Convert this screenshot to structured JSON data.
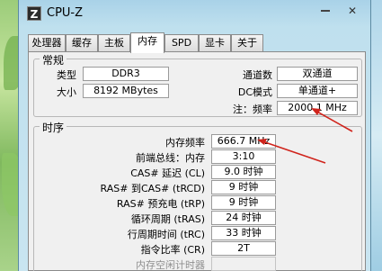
{
  "window": {
    "title": "CPU-Z",
    "icon_letter": "Z",
    "close_glyph": "✕"
  },
  "tabs": [
    {
      "label": "处理器"
    },
    {
      "label": "缓存"
    },
    {
      "label": "主板"
    },
    {
      "label": "内存"
    },
    {
      "label": "SPD"
    },
    {
      "label": "显卡"
    },
    {
      "label": "关于"
    }
  ],
  "active_tab": "内存",
  "general": {
    "title": "常规",
    "type_label": "类型",
    "type_value": "DDR3",
    "size_label": "大小",
    "size_value": "8192 MBytes",
    "channels_label": "通道数",
    "channels_value": "双通道",
    "dc_label": "DC模式",
    "dc_value": "单通道+",
    "freq_label": "注：频率",
    "freq_value": "2000.1 MHz"
  },
  "timings": {
    "title": "时序",
    "rows": [
      {
        "label": "内存频率",
        "value": "666.7 MHz"
      },
      {
        "label": "前端总线：内存",
        "value": "3:10"
      },
      {
        "label": "CAS# 延迟 (CL)",
        "value": "9.0 时钟"
      },
      {
        "label": "RAS# 到CAS# (tRCD)",
        "value": "9 时钟"
      },
      {
        "label": "RAS# 预充电 (tRP)",
        "value": "9 时钟"
      },
      {
        "label": "循环周期 (tRAS)",
        "value": "24 时钟"
      },
      {
        "label": "行周期时间 (tRC)",
        "value": "33 时钟"
      },
      {
        "label": "指令比率 (CR)",
        "value": "2T"
      },
      {
        "label": "内存空闲计时器",
        "value": ""
      }
    ]
  },
  "colors": {
    "arrow": "#d0241c"
  }
}
